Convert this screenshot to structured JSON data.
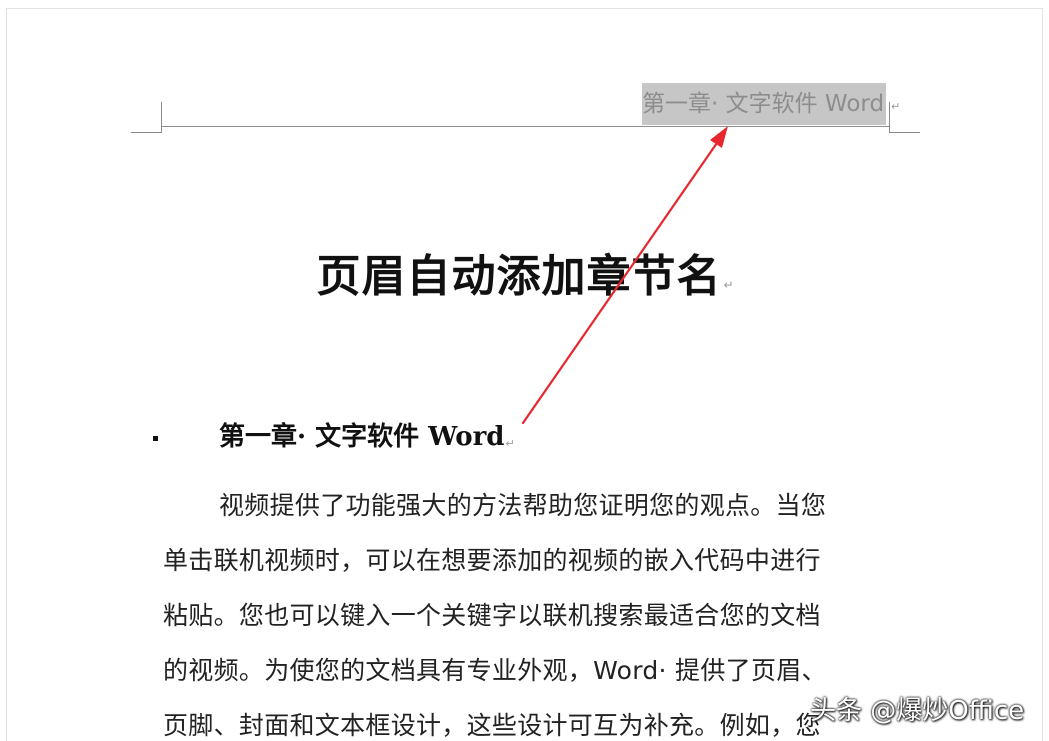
{
  "header": {
    "chapter_text": "第一章· 文字软件 Word",
    "paragraph_mark": "↵"
  },
  "document": {
    "title": "页眉自动添加章节名",
    "title_mark": "↵",
    "heading": "第一章· 文字软件 Word",
    "heading_mark": "↵",
    "body_lines": [
      "视频提供了功能强大的方法帮助您证明您的观点。当您",
      "单击联机视频时，可以在想要添加的视频的嵌入代码中进行",
      "粘贴。您也可以键入一个关键字以联机搜索最适合您的文档",
      "的视频。为使您的文档具有专业外观，Word· 提供了页眉、",
      "页脚、封面和文本框设计，这些设计可互为补充。例如，您"
    ]
  },
  "annotation": {
    "arrow_color": "#e8262d"
  },
  "watermark": {
    "text": "头条 @爆炒Office"
  }
}
